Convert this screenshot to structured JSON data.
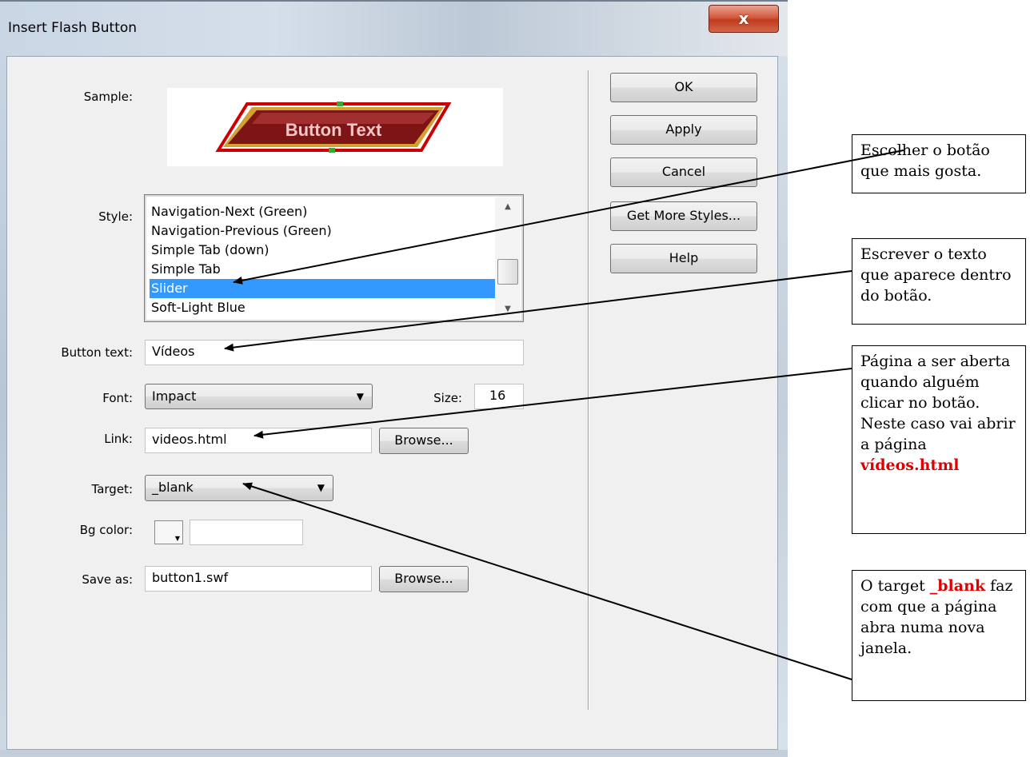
{
  "window": {
    "title": "Insert Flash Button",
    "close_glyph": "x"
  },
  "labels": {
    "sample": "Sample:",
    "style": "Style:",
    "button_text": "Button text:",
    "font": "Font:",
    "size": "Size:",
    "link": "Link:",
    "target": "Target:",
    "bg_color": "Bg color:",
    "save_as": "Save as:"
  },
  "sample_preview": {
    "text": "Button Text",
    "colors": {
      "body": "#8b1a1a",
      "frame": "#d4a032",
      "outline": "#cc0000",
      "text": "#f2c6c6"
    }
  },
  "style_list": {
    "items": [
      "Navigation-Next (Green)",
      "Navigation-Previous (Green)",
      "Simple Tab (down)",
      "Simple Tab",
      "Slider",
      "Soft-Light Blue"
    ],
    "selected": "Slider"
  },
  "fields": {
    "button_text": "Vídeos",
    "font": "Impact",
    "size": "16",
    "link": "videos.html",
    "target": "_blank",
    "bg_color": "",
    "save_as": "button1.swf"
  },
  "buttons": {
    "ok": "OK",
    "apply": "Apply",
    "cancel": "Cancel",
    "get_more_styles": "Get More Styles...",
    "help": "Help",
    "browse_link": "Browse...",
    "browse_save": "Browse..."
  },
  "annotations": {
    "note1": "Escolher o botão que mais gosta.",
    "note2": "Escrever o texto que aparece dentro do botão.",
    "note3_text": "Página a ser aberta quando alguém clicar no botão. Neste caso vai abrir a página ",
    "note3_highlight": "vídeos.html",
    "note4_prefix": "O target ",
    "note4_highlight": "_blank",
    "note4_suffix": " faz com que a página abra numa nova janela."
  },
  "colors": {
    "selection": "#3399ff",
    "highlight_text": "#e00000",
    "dialog_bg": "#f0f0f0",
    "close_button": "#c13b1e"
  }
}
